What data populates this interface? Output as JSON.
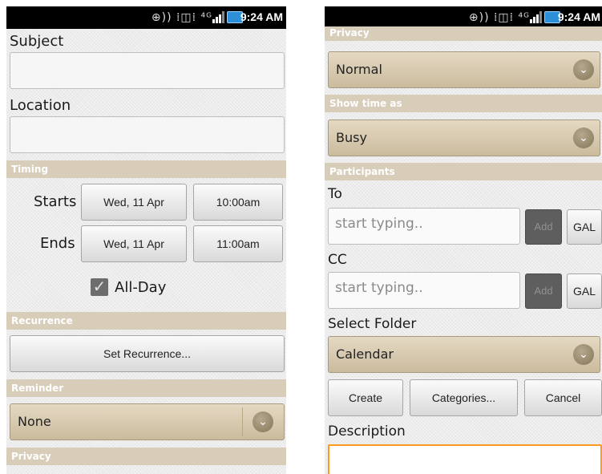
{
  "status_bar": {
    "time": "9:24 AM",
    "icons_text": "⊕)) ⁞◫⁞ ⁴ᴳ"
  },
  "left_screen": {
    "subject_label": "Subject",
    "location_label": "Location",
    "timing_header": "Timing",
    "starts_label": "Starts",
    "start_date": "Wed, 11 Apr",
    "start_time": "10:00am",
    "ends_label": "Ends",
    "end_date": "Wed, 11 Apr",
    "end_time": "11:00am",
    "all_day_label": "All-Day",
    "all_day_checked": true,
    "recurrence_header": "Recurrence",
    "set_recurrence_label": "Set Recurrence...",
    "reminder_header": "Reminder",
    "reminder_value": "None",
    "privacy_header": "Privacy"
  },
  "right_screen": {
    "privacy_header": "Privacy",
    "privacy_value": "Normal",
    "show_time_header": "Show time as",
    "show_time_value": "Busy",
    "participants_header": "Participants",
    "to_label": "To",
    "to_placeholder": "start typing..",
    "cc_label": "CC",
    "cc_placeholder": "start typing..",
    "add_label": "Add",
    "gal_label": "GAL",
    "select_folder_label": "Select Folder",
    "folder_value": "Calendar",
    "create_label": "Create",
    "categories_label": "Categories...",
    "cancel_label": "Cancel",
    "description_label": "Description"
  },
  "colors": {
    "section_bg": "#d8cdb9",
    "spinner_bg": "#cbbb9d",
    "focus_border": "#ff9a1f",
    "battery": "#2d8fd8"
  },
  "icons": {
    "dropdown": "chevron-down-icon",
    "checkbox": "checkmark-icon"
  }
}
